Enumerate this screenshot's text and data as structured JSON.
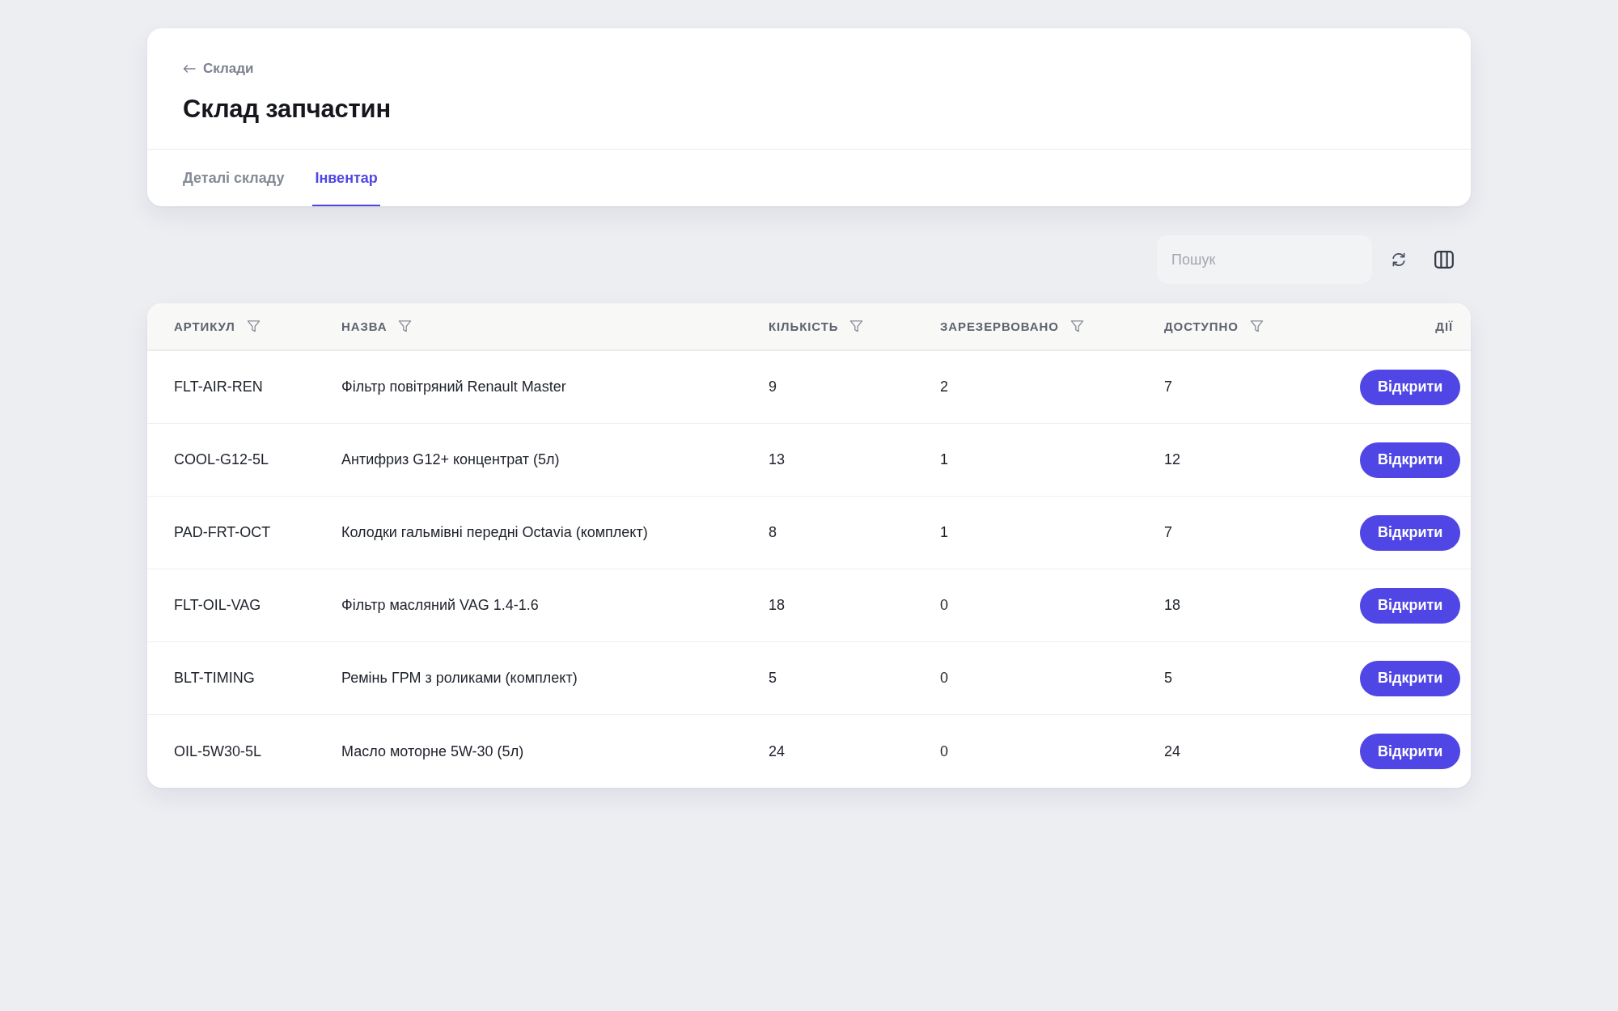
{
  "breadcrumb": {
    "label": "Склади"
  },
  "page_title": "Склад запчастин",
  "tabs": [
    {
      "label": "Деталі складу",
      "selected": false
    },
    {
      "label": "Інвентар",
      "selected": true
    }
  ],
  "toolbar": {
    "search": {
      "placeholder": "Пошук"
    }
  },
  "table": {
    "columns": [
      {
        "label": "АРТИКУЛ",
        "kind": "data"
      },
      {
        "label": "НАЗВА",
        "kind": "data"
      },
      {
        "label": "КІЛЬКІСТЬ",
        "kind": "data"
      },
      {
        "label": "ЗАРЕЗЕРВОВАНО",
        "kind": "data"
      },
      {
        "label": "ДОСТУПНО",
        "kind": "data"
      },
      {
        "label": "ДІЇ",
        "kind": "actions"
      }
    ],
    "rows": [
      {
        "cells": [
          "FLT-AIR-REN",
          "Фільтр повітряний Renault Master",
          "9",
          "2",
          "7"
        ],
        "action": "Відкрити"
      },
      {
        "cells": [
          "COOL-G12-5L",
          "Антифриз G12+ концентрат (5л)",
          "13",
          "1",
          "12"
        ],
        "action": "Відкрити"
      },
      {
        "cells": [
          "PAD-FRT-OCT",
          "Колодки гальмівні передні Octavia (комплект)",
          "8",
          "1",
          "7"
        ],
        "action": "Відкрити"
      },
      {
        "cells": [
          "FLT-OIL-VAG",
          "Фільтр масляний VAG 1.4-1.6",
          "18",
          "0",
          "18"
        ],
        "action": "Відкрити"
      },
      {
        "cells": [
          "BLT-TIMING",
          "Ремінь ГРМ з роликами (комплект)",
          "5",
          "0",
          "5"
        ],
        "action": "Відкрити"
      },
      {
        "cells": [
          "OIL-5W30-5L",
          "Масло моторне 5W-30 (5л)",
          "24",
          "0",
          "24"
        ],
        "action": "Відкрити"
      }
    ]
  }
}
